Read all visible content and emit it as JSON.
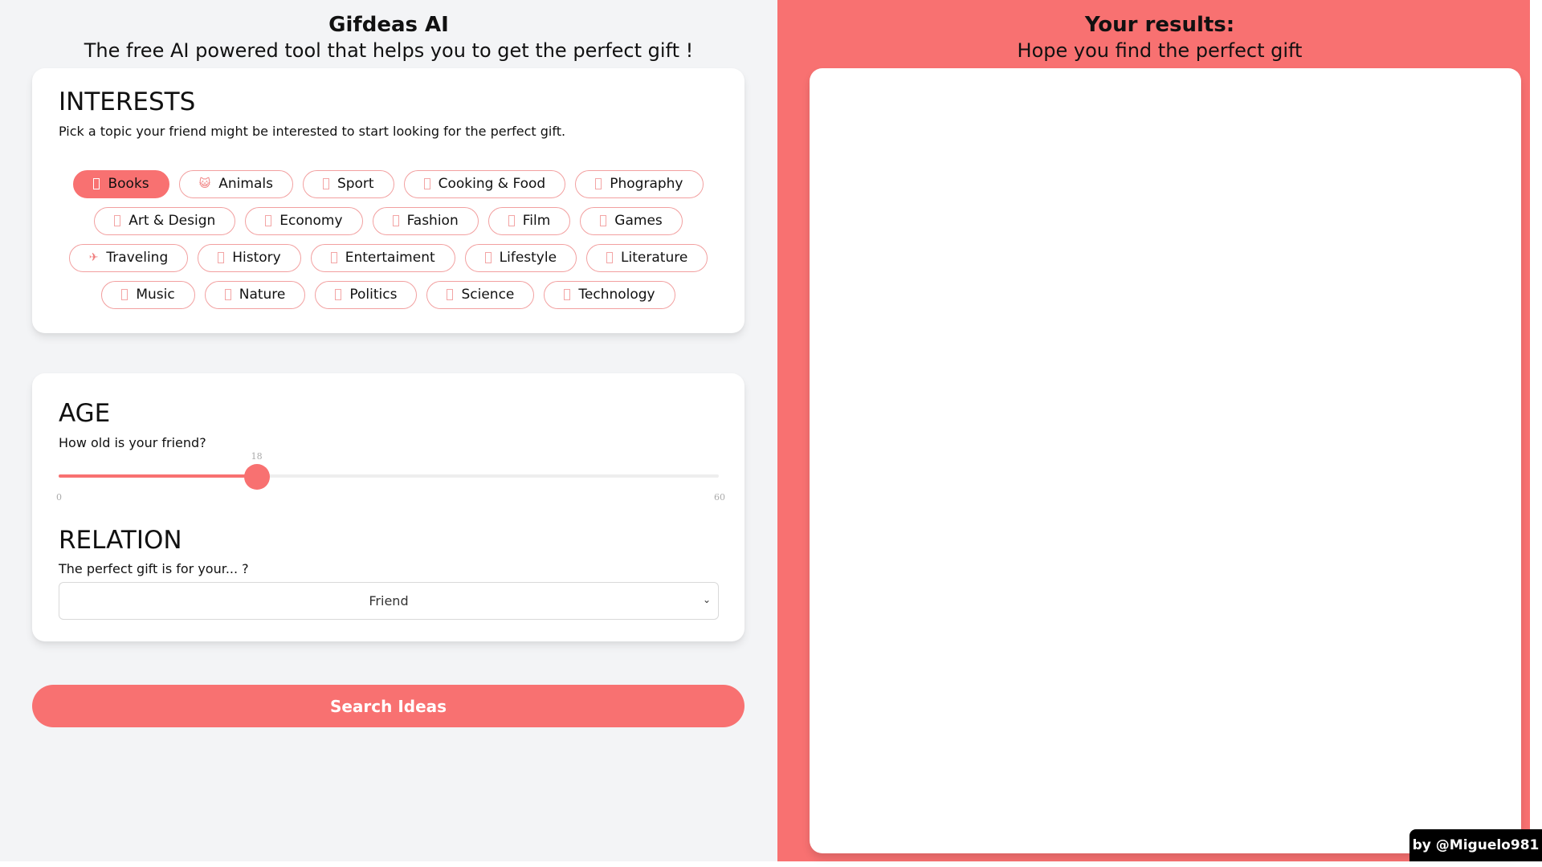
{
  "app": {
    "title": "Gifdeas AI",
    "subtitle": "The free AI powered tool that helps you to get the perfect gift !"
  },
  "colors": {
    "accent": "#f87171",
    "left_bg": "#f3f4f6",
    "chip_border": "#f2a0a0"
  },
  "interests": {
    "title": "INTERESTS",
    "description": "Pick a topic your friend might be interested to start looking for the perfect gift.",
    "rows": [
      [
        {
          "label": "Books",
          "icon": "book-icon",
          "glyph": "tofu",
          "selected": true
        },
        {
          "label": "Animals",
          "icon": "cat-face-icon",
          "glyph": "😺",
          "selected": false
        },
        {
          "label": "Sport",
          "icon": "sport-icon",
          "glyph": "tofu",
          "selected": false
        },
        {
          "label": "Cooking & Food",
          "icon": "cooking-icon",
          "glyph": "tofu",
          "selected": false
        },
        {
          "label": "Phography",
          "icon": "camera-icon",
          "glyph": "tofu",
          "selected": false
        }
      ],
      [
        {
          "label": "Art & Design",
          "icon": "art-icon",
          "glyph": "tofu",
          "selected": false
        },
        {
          "label": "Economy",
          "icon": "economy-icon",
          "glyph": "tofu",
          "selected": false
        },
        {
          "label": "Fashion",
          "icon": "fashion-icon",
          "glyph": "tofu",
          "selected": false
        },
        {
          "label": "Film",
          "icon": "film-icon",
          "glyph": "tofu",
          "selected": false
        },
        {
          "label": "Games",
          "icon": "games-icon",
          "glyph": "tofu",
          "selected": false
        }
      ],
      [
        {
          "label": "Traveling",
          "icon": "airplane-icon",
          "glyph": "✈",
          "selected": false
        },
        {
          "label": "History",
          "icon": "history-icon",
          "glyph": "tofu",
          "selected": false
        },
        {
          "label": "Entertaiment",
          "icon": "entertainment-icon",
          "glyph": "tofu",
          "selected": false
        },
        {
          "label": "Lifestyle",
          "icon": "lifestyle-icon",
          "glyph": "tofu",
          "selected": false
        },
        {
          "label": "Literature",
          "icon": "literature-icon",
          "glyph": "tofu",
          "selected": false
        }
      ],
      [
        {
          "label": "Music",
          "icon": "music-icon",
          "glyph": "tofu",
          "selected": false
        },
        {
          "label": "Nature",
          "icon": "nature-icon",
          "glyph": "tofu",
          "selected": false
        },
        {
          "label": "Politics",
          "icon": "politics-icon",
          "glyph": "tofu",
          "selected": false
        },
        {
          "label": "Science",
          "icon": "science-icon",
          "glyph": "tofu",
          "selected": false
        },
        {
          "label": "Technology",
          "icon": "technology-icon",
          "glyph": "tofu",
          "selected": false
        }
      ]
    ]
  },
  "age": {
    "title": "AGE",
    "description": "How old is your friend?",
    "min": 0,
    "max": 60,
    "value": 18,
    "min_label": "0",
    "max_label": "60",
    "value_label": "18"
  },
  "relation": {
    "title": "RELATION",
    "description": "The perfect gift is for your... ?",
    "selected": "Friend"
  },
  "search_button": {
    "label": "Search Ideas"
  },
  "results": {
    "title": "Your results:",
    "subtitle": "Hope you find the perfect gift"
  },
  "credit": {
    "label": "by @Miguelo981"
  }
}
